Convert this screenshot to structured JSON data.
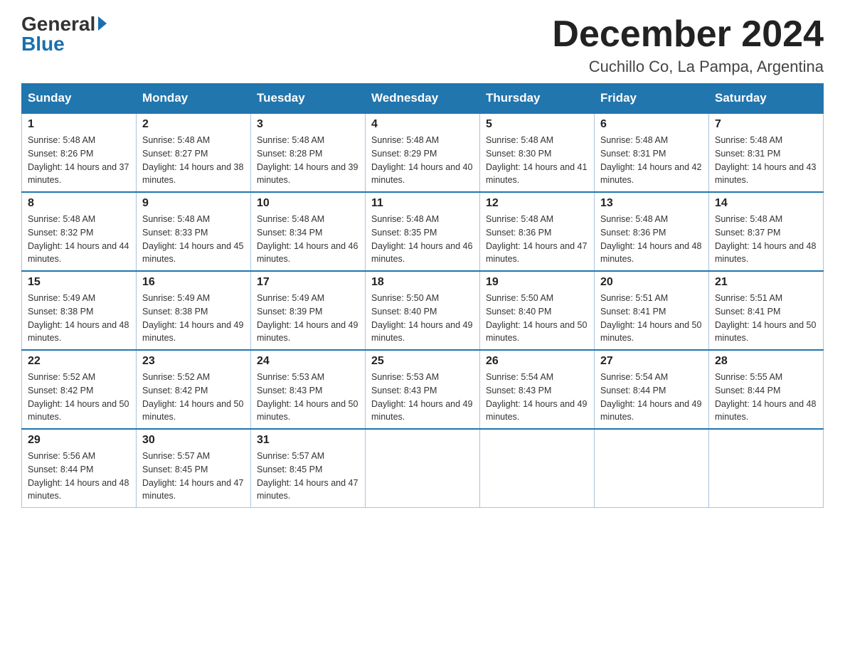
{
  "header": {
    "logo_general": "General",
    "logo_blue": "Blue",
    "month_title": "December 2024",
    "location": "Cuchillo Co, La Pampa, Argentina"
  },
  "weekdays": [
    "Sunday",
    "Monday",
    "Tuesday",
    "Wednesday",
    "Thursday",
    "Friday",
    "Saturday"
  ],
  "weeks": [
    [
      {
        "day": 1,
        "sunrise": "5:48 AM",
        "sunset": "8:26 PM",
        "daylight": "14 hours and 37 minutes."
      },
      {
        "day": 2,
        "sunrise": "5:48 AM",
        "sunset": "8:27 PM",
        "daylight": "14 hours and 38 minutes."
      },
      {
        "day": 3,
        "sunrise": "5:48 AM",
        "sunset": "8:28 PM",
        "daylight": "14 hours and 39 minutes."
      },
      {
        "day": 4,
        "sunrise": "5:48 AM",
        "sunset": "8:29 PM",
        "daylight": "14 hours and 40 minutes."
      },
      {
        "day": 5,
        "sunrise": "5:48 AM",
        "sunset": "8:30 PM",
        "daylight": "14 hours and 41 minutes."
      },
      {
        "day": 6,
        "sunrise": "5:48 AM",
        "sunset": "8:31 PM",
        "daylight": "14 hours and 42 minutes."
      },
      {
        "day": 7,
        "sunrise": "5:48 AM",
        "sunset": "8:31 PM",
        "daylight": "14 hours and 43 minutes."
      }
    ],
    [
      {
        "day": 8,
        "sunrise": "5:48 AM",
        "sunset": "8:32 PM",
        "daylight": "14 hours and 44 minutes."
      },
      {
        "day": 9,
        "sunrise": "5:48 AM",
        "sunset": "8:33 PM",
        "daylight": "14 hours and 45 minutes."
      },
      {
        "day": 10,
        "sunrise": "5:48 AM",
        "sunset": "8:34 PM",
        "daylight": "14 hours and 46 minutes."
      },
      {
        "day": 11,
        "sunrise": "5:48 AM",
        "sunset": "8:35 PM",
        "daylight": "14 hours and 46 minutes."
      },
      {
        "day": 12,
        "sunrise": "5:48 AM",
        "sunset": "8:36 PM",
        "daylight": "14 hours and 47 minutes."
      },
      {
        "day": 13,
        "sunrise": "5:48 AM",
        "sunset": "8:36 PM",
        "daylight": "14 hours and 48 minutes."
      },
      {
        "day": 14,
        "sunrise": "5:48 AM",
        "sunset": "8:37 PM",
        "daylight": "14 hours and 48 minutes."
      }
    ],
    [
      {
        "day": 15,
        "sunrise": "5:49 AM",
        "sunset": "8:38 PM",
        "daylight": "14 hours and 48 minutes."
      },
      {
        "day": 16,
        "sunrise": "5:49 AM",
        "sunset": "8:38 PM",
        "daylight": "14 hours and 49 minutes."
      },
      {
        "day": 17,
        "sunrise": "5:49 AM",
        "sunset": "8:39 PM",
        "daylight": "14 hours and 49 minutes."
      },
      {
        "day": 18,
        "sunrise": "5:50 AM",
        "sunset": "8:40 PM",
        "daylight": "14 hours and 49 minutes."
      },
      {
        "day": 19,
        "sunrise": "5:50 AM",
        "sunset": "8:40 PM",
        "daylight": "14 hours and 50 minutes."
      },
      {
        "day": 20,
        "sunrise": "5:51 AM",
        "sunset": "8:41 PM",
        "daylight": "14 hours and 50 minutes."
      },
      {
        "day": 21,
        "sunrise": "5:51 AM",
        "sunset": "8:41 PM",
        "daylight": "14 hours and 50 minutes."
      }
    ],
    [
      {
        "day": 22,
        "sunrise": "5:52 AM",
        "sunset": "8:42 PM",
        "daylight": "14 hours and 50 minutes."
      },
      {
        "day": 23,
        "sunrise": "5:52 AM",
        "sunset": "8:42 PM",
        "daylight": "14 hours and 50 minutes."
      },
      {
        "day": 24,
        "sunrise": "5:53 AM",
        "sunset": "8:43 PM",
        "daylight": "14 hours and 50 minutes."
      },
      {
        "day": 25,
        "sunrise": "5:53 AM",
        "sunset": "8:43 PM",
        "daylight": "14 hours and 49 minutes."
      },
      {
        "day": 26,
        "sunrise": "5:54 AM",
        "sunset": "8:43 PM",
        "daylight": "14 hours and 49 minutes."
      },
      {
        "day": 27,
        "sunrise": "5:54 AM",
        "sunset": "8:44 PM",
        "daylight": "14 hours and 49 minutes."
      },
      {
        "day": 28,
        "sunrise": "5:55 AM",
        "sunset": "8:44 PM",
        "daylight": "14 hours and 48 minutes."
      }
    ],
    [
      {
        "day": 29,
        "sunrise": "5:56 AM",
        "sunset": "8:44 PM",
        "daylight": "14 hours and 48 minutes."
      },
      {
        "day": 30,
        "sunrise": "5:57 AM",
        "sunset": "8:45 PM",
        "daylight": "14 hours and 47 minutes."
      },
      {
        "day": 31,
        "sunrise": "5:57 AM",
        "sunset": "8:45 PM",
        "daylight": "14 hours and 47 minutes."
      },
      null,
      null,
      null,
      null
    ]
  ]
}
